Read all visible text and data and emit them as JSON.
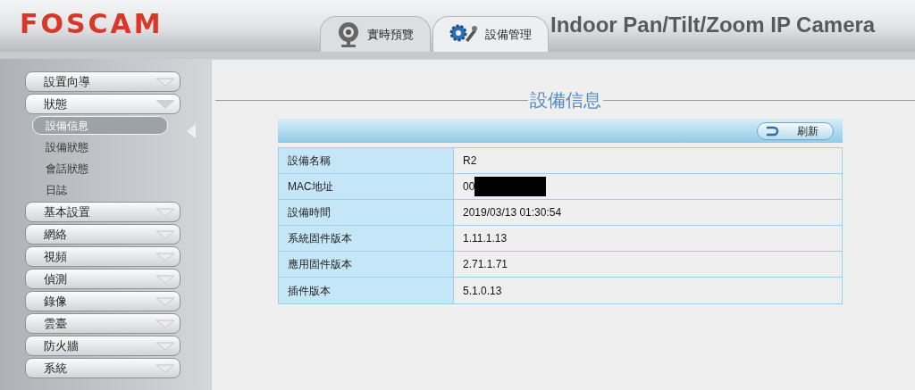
{
  "header": {
    "logo": "FOSCAM",
    "tabs": [
      {
        "label": "實時預覽",
        "kind": "camera",
        "selected": false
      },
      {
        "label": "設備管理",
        "kind": "tools",
        "selected": true
      }
    ],
    "title": "Indoor Pan/Tilt/Zoom IP Camera"
  },
  "sidebar": {
    "items": [
      {
        "label": "設置向導",
        "expanded": false
      },
      {
        "label": "狀態",
        "expanded": true,
        "children": [
          {
            "label": "設備信息",
            "selected": true
          },
          {
            "label": "設備狀態",
            "selected": false
          },
          {
            "label": "會話狀態",
            "selected": false
          },
          {
            "label": "日誌",
            "selected": false
          }
        ]
      },
      {
        "label": "基本設置",
        "expanded": false
      },
      {
        "label": "網絡",
        "expanded": false
      },
      {
        "label": "視頻",
        "expanded": false
      },
      {
        "label": "偵測",
        "expanded": false
      },
      {
        "label": "錄像",
        "expanded": false
      },
      {
        "label": "雲臺",
        "expanded": false
      },
      {
        "label": "防火牆",
        "expanded": false
      },
      {
        "label": "系統",
        "expanded": false
      }
    ]
  },
  "panel": {
    "title": "設備信息",
    "refresh_button": "刷新",
    "rows": [
      {
        "label": "設備名稱",
        "value": "R2",
        "redacted": false
      },
      {
        "label": "MAC地址",
        "value": "00",
        "redacted": true
      },
      {
        "label": "設備時間",
        "value": "2019/03/13 01:30:54",
        "redacted": false
      },
      {
        "label": "系統固件版本",
        "value": "1.11.1.13",
        "redacted": false
      },
      {
        "label": "應用固件版本",
        "value": "2.71.1.71",
        "redacted": false
      },
      {
        "label": "插件版本",
        "value": "5.1.0.13",
        "redacted": false
      }
    ]
  }
}
